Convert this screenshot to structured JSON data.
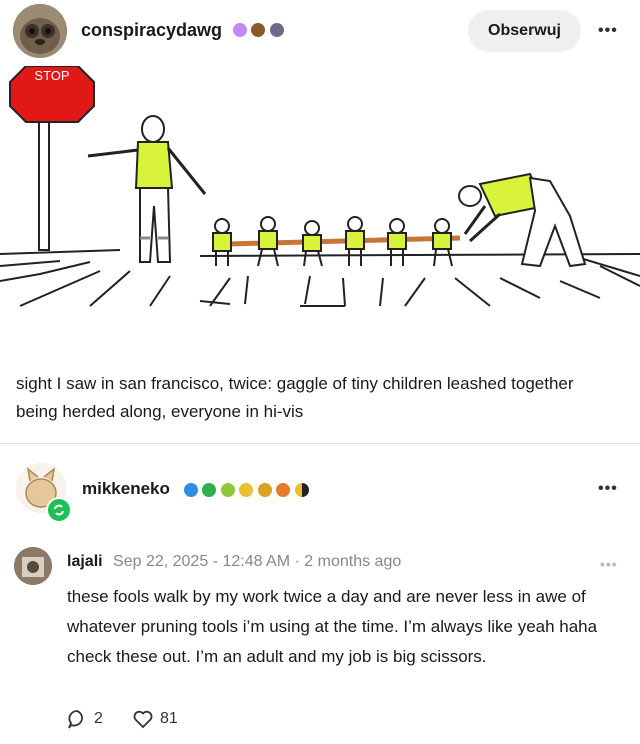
{
  "post": {
    "author": "conspiracydawg",
    "follow_label": "Obserwuj",
    "more_label": "•••",
    "image_sign_text": "STOP",
    "body": "sight I saw in san francisco, twice: gaggle of tiny children leashed together being herded along, everyone in hi-vis"
  },
  "reblog": {
    "author": "mikkeneko",
    "more_label": "•••"
  },
  "comment": {
    "author": "lajali",
    "date": "Sep 22, 2025 - 12:48 AM",
    "separator": "·",
    "relative": "2 months ago",
    "more_label": "•••",
    "body": "these fools walk by my work twice a day and are never less in awe of whatever pruning tools i’m using at the time. I’m always like yeah haha check these out. I’m an adult and my job is big scissors.",
    "replies": "2",
    "likes": "81"
  },
  "colors": {
    "hivis": "#d9f23a",
    "stop_red": "#e01818",
    "reblog_green": "#1fbf55"
  },
  "icons": [
    "avatar-conspiracydawg",
    "purple-badge",
    "brown-badge",
    "gray-badge",
    "reblog-icon",
    "comment-icon",
    "heart-icon"
  ]
}
